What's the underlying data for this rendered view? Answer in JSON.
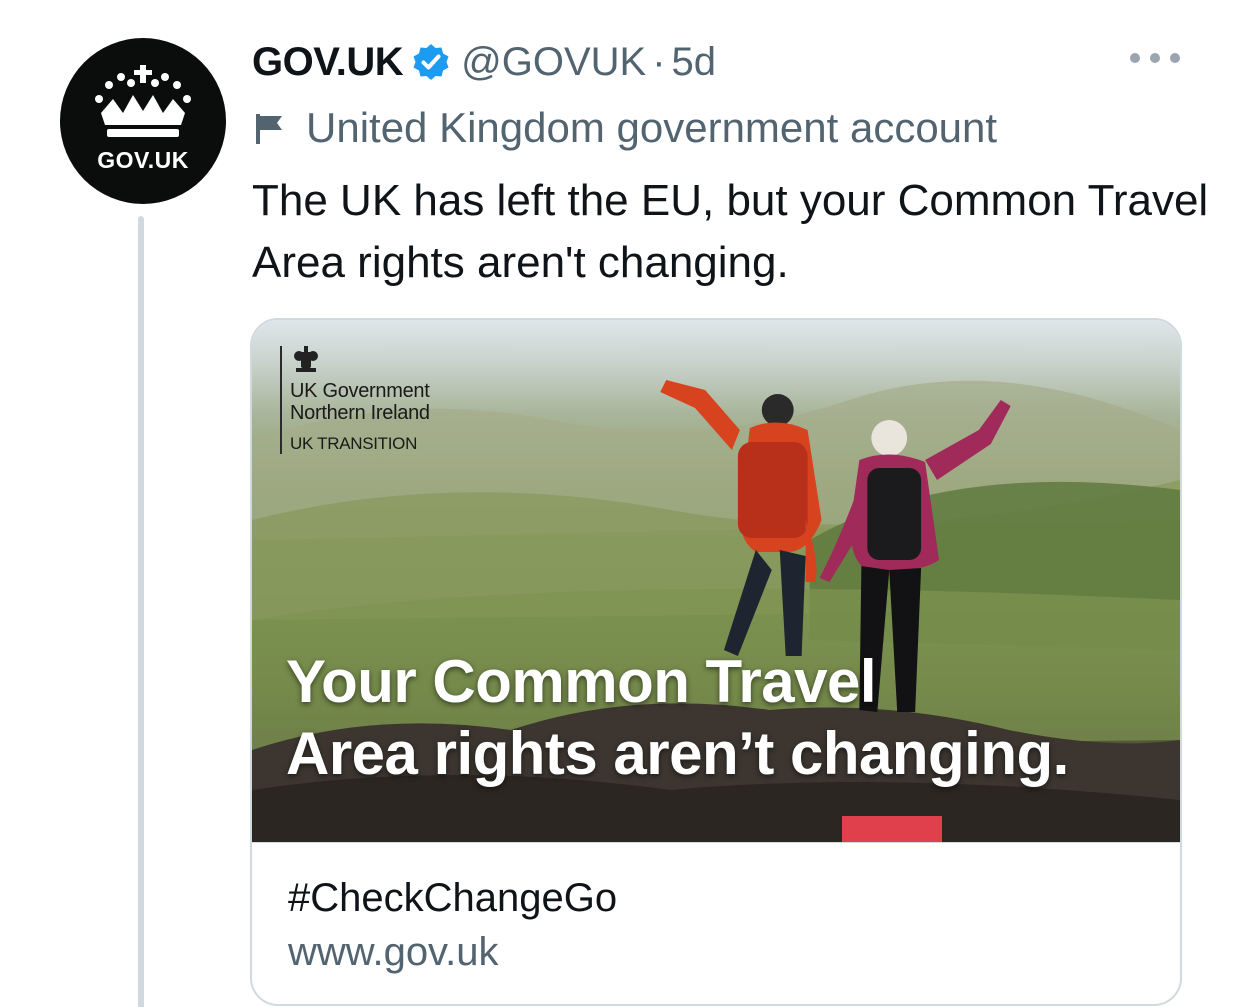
{
  "avatar": {
    "label": "GOV.UK",
    "icon": "crown-icon"
  },
  "tweet": {
    "display_name": "GOV.UK",
    "handle": "@GOVUK",
    "separator": "·",
    "time": "5d",
    "verified": true,
    "account_label": "United Kingdom government account",
    "text": "The UK has left the EU, but your Common Travel Area rights aren't changing."
  },
  "card": {
    "image": {
      "brand_line1": "UK Government",
      "brand_line2": "Northern Ireland",
      "brand_line3": "UK TRANSITION",
      "headline_line1": "Your Common Travel",
      "headline_line2": "Area rights aren’t changing."
    },
    "title": "#CheckChangeGo",
    "domain": "www.gov.uk"
  },
  "colors": {
    "verified_blue": "#1d9bf0",
    "secondary_text": "#536471",
    "thread_line": "#cfd9de",
    "accent_red": "#e0404b"
  }
}
